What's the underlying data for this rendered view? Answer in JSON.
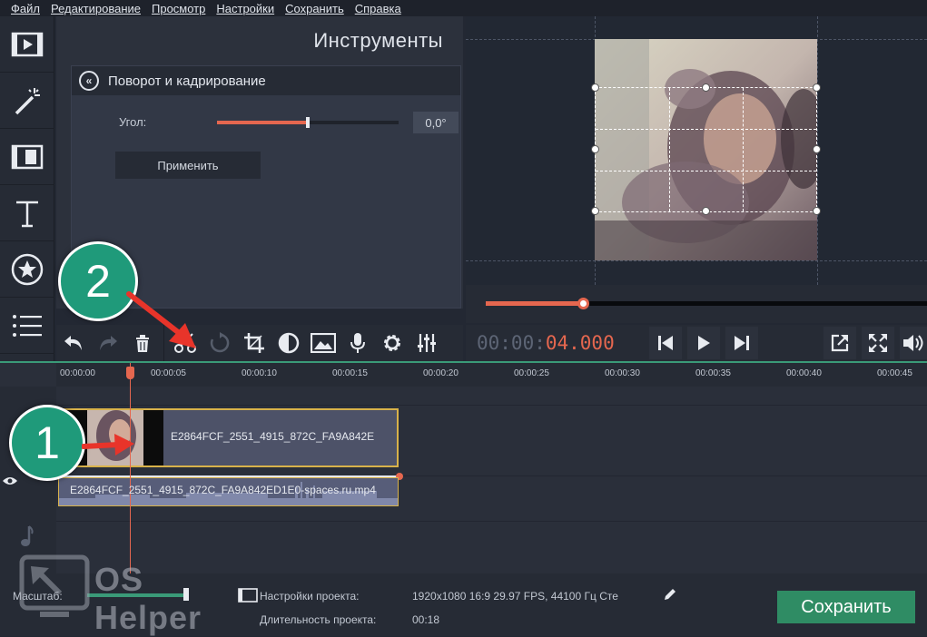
{
  "menu": {
    "items": [
      "Файл",
      "Редактирование",
      "Просмотр",
      "Настройки",
      "Сохранить",
      "Справка"
    ]
  },
  "sidebar": {
    "items": [
      {
        "icon": "film-icon"
      },
      {
        "icon": "magic-wand-icon"
      },
      {
        "icon": "transition-icon"
      },
      {
        "icon": "title-text-icon"
      },
      {
        "icon": "sticker-star-icon"
      },
      {
        "icon": "list-icon"
      }
    ]
  },
  "tools": {
    "title": "Инструменты",
    "panel": {
      "back_icon": "back-chevron-icon",
      "title": "Поворот и кадрирование",
      "angle_label": "Угол:",
      "angle_value": "0,0°",
      "angle_level": 0.5,
      "apply_label": "Применить"
    }
  },
  "toolbar": {
    "buttons": [
      "undo-icon",
      "redo-icon",
      "delete-icon",
      "scissors-icon",
      "rotate-icon",
      "crop-icon",
      "color-adjust-icon",
      "image-icon",
      "microphone-icon",
      "gear-icon",
      "equalizer-icon"
    ]
  },
  "player": {
    "timecode_dim": "00:00:",
    "timecode_lit": "04.000",
    "progress": 0.22,
    "buttons": [
      "prev-frame-icon",
      "play-icon",
      "next-frame-icon",
      "popout-icon",
      "fullscreen-icon",
      "volume-icon"
    ]
  },
  "timeline": {
    "ticks": [
      "00:00:00",
      "00:00:05",
      "00:00:10",
      "00:00:15",
      "00:00:20",
      "00:00:25",
      "00:00:30",
      "00:00:35",
      "00:00:40",
      "00:00:45"
    ],
    "video_clip_name": "E2864FCF_2551_4915_872C_FA9A842E",
    "audio_clip_name": "E2864FCF_2551_4915_872C_FA9A842ED1E0-spaces.ru.mp4"
  },
  "bottom": {
    "scale_label": "Масштаб:",
    "project_settings_label": "Настройки проекта:",
    "project_settings_value": "1920x1080 16:9 29.97 FPS, 44100 Гц Сте",
    "duration_label": "Длительность проекта:",
    "duration_value": "00:18",
    "save_label": "Сохранить"
  },
  "annotations": {
    "badge_1": "1",
    "badge_2": "2",
    "watermark": "OS Helper"
  },
  "colors": {
    "accent": "#e5674f",
    "save": "#2f8c64",
    "badge": "#1f9a7a"
  }
}
